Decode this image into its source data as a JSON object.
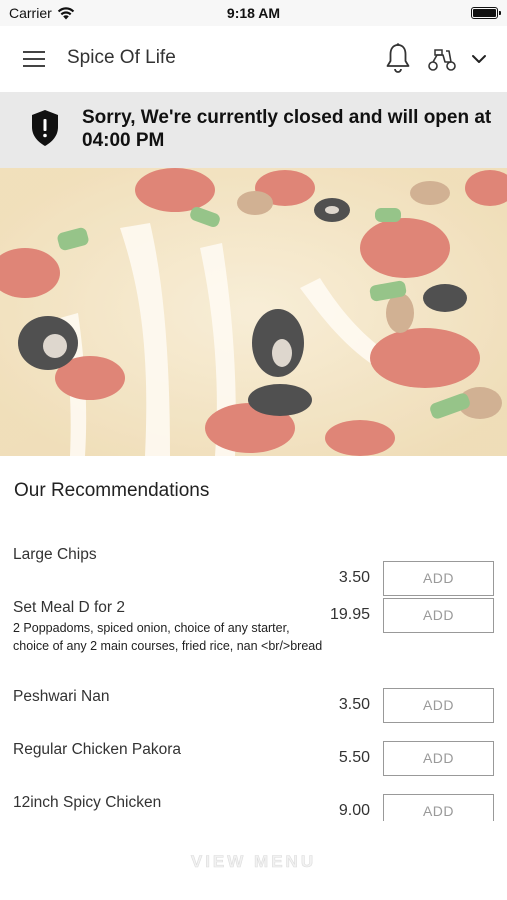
{
  "status_bar": {
    "carrier": "Carrier",
    "time": "9:18 AM"
  },
  "header": {
    "title": "Spice Of Life",
    "icons": [
      "hamburger-menu-icon",
      "bell-icon",
      "scooter-icon",
      "chevron-down-icon"
    ]
  },
  "banner": {
    "message": "Sorry, We're currently closed and will open at 04:00 PM",
    "icon": "shield-alert-icon"
  },
  "hero": {
    "image": "pizza-photo"
  },
  "recommendations": {
    "heading": "Our Recommendations",
    "items": [
      {
        "name": "Large Chips",
        "description": "",
        "price": "3.50",
        "button": "ADD"
      },
      {
        "name": "Set Meal D for 2",
        "description": "2 Poppadoms, spiced onion, choice of any starter, choice of any 2 main courses, fried rice, nan <br/>bread",
        "price": "19.95",
        "button": "ADD"
      },
      {
        "name": "Peshwari Nan",
        "description": "",
        "price": "3.50",
        "button": "ADD"
      },
      {
        "name": "Regular Chicken Pakora",
        "description": "",
        "price": "5.50",
        "button": "ADD"
      },
      {
        "name": "12inch Spicy Chicken",
        "description": "",
        "price": "9.00",
        "button": "ADD"
      }
    ]
  },
  "footer": {
    "view_menu": "VIEW MENU"
  }
}
